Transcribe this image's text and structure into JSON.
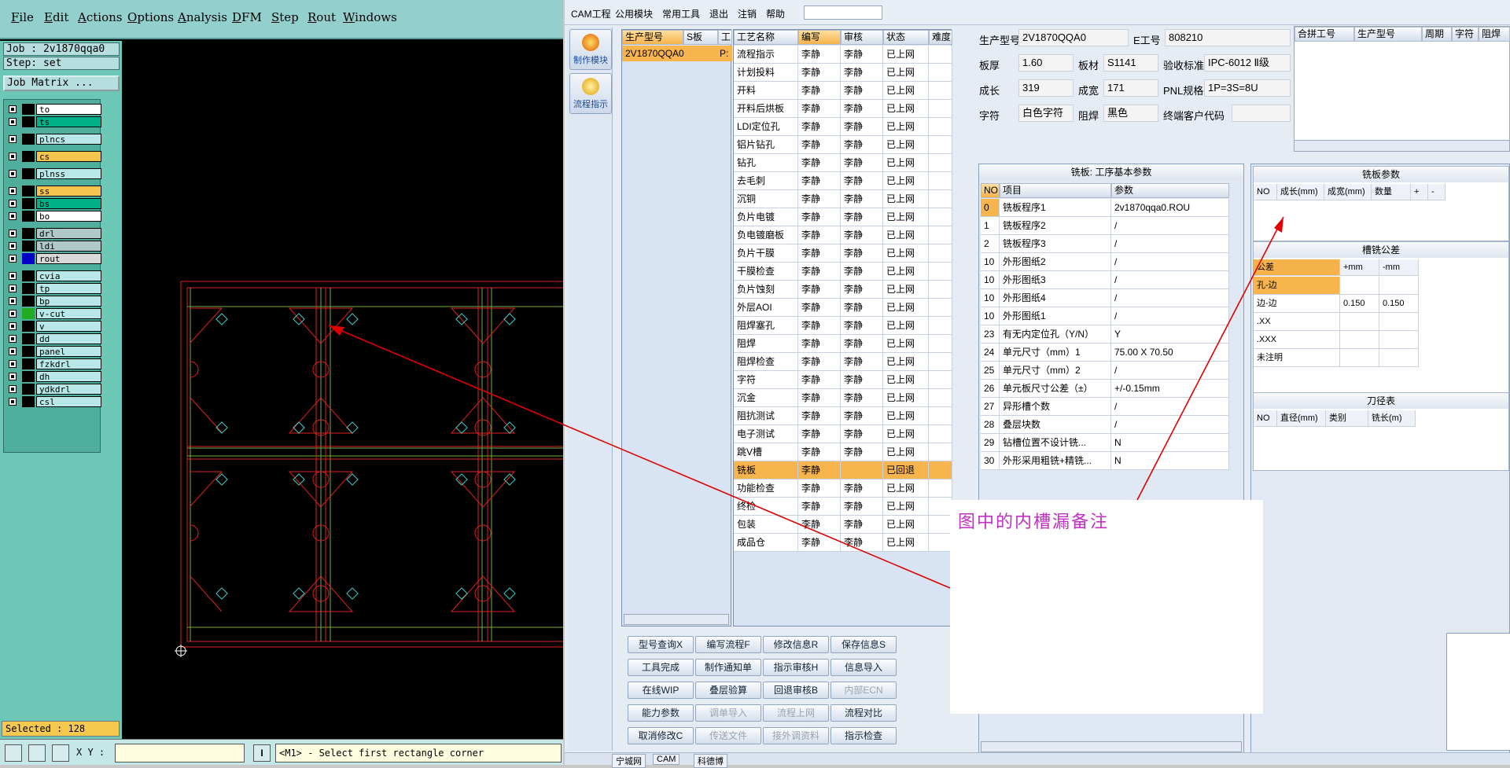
{
  "left_app": {
    "menu": [
      "File",
      "Edit",
      "Actions",
      "Options",
      "Analysis",
      "DFM",
      "Step",
      "Rout",
      "Windows"
    ],
    "job": "Job : 2v1870qqa0",
    "step": "Step: set",
    "job_matrix": "Job Matrix ...",
    "layers": [
      {
        "name": "to",
        "color": "#ffffff"
      },
      {
        "name": "ts",
        "color": "#00b28a"
      },
      {
        "name": "plncs",
        "color": "#b9e8e8"
      },
      {
        "name": "cs",
        "color": "#f6c54d"
      },
      {
        "name": "plnss",
        "color": "#b9e8e8"
      },
      {
        "name": "ss",
        "color": "#f6c54d"
      },
      {
        "name": "bs",
        "color": "#00b28a"
      },
      {
        "name": "bo",
        "color": "#ffffff"
      },
      {
        "name": "drl",
        "color": "#b0c8c8"
      },
      {
        "name": "ldi",
        "color": "#b0c8c8"
      },
      {
        "name": "rout",
        "color": "#d9d9d9"
      },
      {
        "name": "cvia",
        "color": "#b9e8e8"
      },
      {
        "name": "tp",
        "color": "#b9e8e8"
      },
      {
        "name": "bp",
        "color": "#b9e8e8"
      },
      {
        "name": "v-cut",
        "color": "#b9e8e8"
      },
      {
        "name": "v",
        "color": "#b9e8e8"
      },
      {
        "name": "dd",
        "color": "#b9e8e8"
      },
      {
        "name": "panel",
        "color": "#b9e8e8"
      },
      {
        "name": "fzkdrl",
        "color": "#b9e8e8"
      },
      {
        "name": "dh",
        "color": "#b9e8e8"
      },
      {
        "name": "ydkdrl",
        "color": "#b9e8e8"
      },
      {
        "name": "csl",
        "color": "#b9e8e8"
      }
    ],
    "selected": "Selected : 128",
    "coord_label": "X Y :",
    "prompt": "<M1> - Select first rectangle corner"
  },
  "right_app": {
    "menu": [
      "CAM工程",
      "公用模块",
      "常用工具",
      "退出",
      "注销",
      "帮助"
    ],
    "side_buttons": [
      "制作模块",
      "流程指示"
    ],
    "model_list": {
      "headers": [
        "生产型号",
        "S板",
        "工"
      ],
      "rows": [
        {
          "model": "2V1870QQA0",
          "s": "P:"
        }
      ]
    },
    "process": {
      "headers": [
        "工艺名称",
        "编写",
        "审核",
        "状态",
        "难度"
      ],
      "rows": [
        [
          "流程指示",
          "李静",
          "李静",
          "已上网",
          ""
        ],
        [
          "计划投料",
          "李静",
          "李静",
          "已上网",
          ""
        ],
        [
          "开料",
          "李静",
          "李静",
          "已上网",
          ""
        ],
        [
          "开料后烘板",
          "李静",
          "李静",
          "已上网",
          ""
        ],
        [
          "LDI定位孔",
          "李静",
          "李静",
          "已上网",
          ""
        ],
        [
          "铝片钻孔",
          "李静",
          "李静",
          "已上网",
          ""
        ],
        [
          "钻孔",
          "李静",
          "李静",
          "已上网",
          ""
        ],
        [
          "去毛刺",
          "李静",
          "李静",
          "已上网",
          ""
        ],
        [
          "沉铜",
          "李静",
          "李静",
          "已上网",
          ""
        ],
        [
          "负片电镀",
          "李静",
          "李静",
          "已上网",
          ""
        ],
        [
          "负电镀磨板",
          "李静",
          "李静",
          "已上网",
          ""
        ],
        [
          "负片干膜",
          "李静",
          "李静",
          "已上网",
          ""
        ],
        [
          "干膜检查",
          "李静",
          "李静",
          "已上网",
          ""
        ],
        [
          "负片蚀刻",
          "李静",
          "李静",
          "已上网",
          ""
        ],
        [
          "外层AOI",
          "李静",
          "李静",
          "已上网",
          ""
        ],
        [
          "阻焊塞孔",
          "李静",
          "李静",
          "已上网",
          ""
        ],
        [
          "阻焊",
          "李静",
          "李静",
          "已上网",
          ""
        ],
        [
          "阻焊检查",
          "李静",
          "李静",
          "已上网",
          ""
        ],
        [
          "字符",
          "李静",
          "李静",
          "已上网",
          ""
        ],
        [
          "沉金",
          "李静",
          "李静",
          "已上网",
          ""
        ],
        [
          "阻抗测试",
          "李静",
          "李静",
          "已上网",
          ""
        ],
        [
          "电子测试",
          "李静",
          "李静",
          "已上网",
          ""
        ],
        [
          "跳V槽",
          "李静",
          "李静",
          "已上网",
          ""
        ],
        [
          "铣板",
          "李静",
          "",
          "已回退",
          ""
        ],
        [
          "功能检查",
          "李静",
          "李静",
          "已上网",
          ""
        ],
        [
          "终检",
          "李静",
          "李静",
          "已上网",
          ""
        ],
        [
          "包装",
          "李静",
          "李静",
          "已上网",
          ""
        ],
        [
          "成品仓",
          "李静",
          "李静",
          "已上网",
          ""
        ]
      ],
      "selected_index": 23
    },
    "info": {
      "model_label": "生产型号",
      "model": "2V1870QQA0",
      "eng_label": "E工号",
      "eng": "808210",
      "thick_label": "板厚",
      "thick": "1.60",
      "mat_label": "板材",
      "mat": "S1141",
      "std_label": "验收标准",
      "std": "IPC-6012 Ⅱ级",
      "len_label": "成长",
      "len": "319",
      "wid_label": "成宽",
      "wid": "171",
      "pnl_label": "PNL规格",
      "pnl": "1P=3S=8U",
      "char_label": "字符",
      "char": "白色字符",
      "mask_label": "阻焊",
      "mask": "黑色",
      "cust_label": "终端客户代码",
      "cust": ""
    },
    "merge_headers": [
      "合拼工号",
      "生产型号",
      "周期",
      "字符",
      "阻焊"
    ],
    "params": {
      "title": "铣板: 工序基本参数",
      "headers": [
        "NO",
        "项目",
        "参数"
      ],
      "rows": [
        [
          "0",
          "铣板程序1",
          "2v1870qqa0.ROU"
        ],
        [
          "1",
          "铣板程序2",
          "/"
        ],
        [
          "2",
          "铣板程序3",
          "/"
        ],
        [
          "10",
          "外形图纸2",
          "/"
        ],
        [
          "10",
          "外形图纸3",
          "/"
        ],
        [
          "10",
          "外形图纸4",
          "/"
        ],
        [
          "10",
          "外形图纸1",
          "/"
        ],
        [
          "23",
          "有无内定位孔（Y/N）",
          "Y"
        ],
        [
          "24",
          "单元尺寸（mm）1",
          "75.00 X 70.50"
        ],
        [
          "25",
          "单元尺寸（mm）2",
          "/"
        ],
        [
          "26",
          "单元板尺寸公差（±）",
          "+/-0.15mm"
        ],
        [
          "27",
          "异形槽个数",
          "/"
        ],
        [
          "28",
          "叠层块数",
          "/"
        ],
        [
          "29",
          "钻槽位置不设计铣...",
          "N"
        ],
        [
          "30",
          "外形采用粗铣+精铣...",
          "N"
        ]
      ]
    },
    "mill_params": {
      "title": "铣板参数",
      "headers": [
        "NO",
        "成长(mm)",
        "成宽(mm)",
        "数量",
        "+",
        "-"
      ]
    },
    "tolerance": {
      "title": "槽铣公差",
      "headers": [
        "公差",
        "+mm",
        "-mm"
      ],
      "rows": [
        [
          "孔-边",
          "",
          ""
        ],
        [
          "边-边",
          "0.150",
          "0.150"
        ],
        [
          ".XX",
          "",
          ""
        ],
        [
          ".XXX",
          "",
          ""
        ],
        [
          "未注明",
          "",
          ""
        ]
      ]
    },
    "tools": {
      "title": "刀径表",
      "headers": [
        "NO",
        "直径(mm)",
        "类别",
        "铣长(m)"
      ]
    },
    "buttons": [
      [
        "型号查询X",
        "编写流程F",
        "修改信息R",
        "保存信息S"
      ],
      [
        "工具完成",
        "制作通知单",
        "指示审核H",
        "信息导入"
      ],
      [
        "在线WIP",
        "叠层验算",
        "回退审核B",
        "内部ECN"
      ],
      [
        "能力参数",
        "调单导入",
        "流程上网",
        "流程对比"
      ],
      [
        "取消修改C",
        "传送文件",
        "接外调资料",
        "指示检查"
      ]
    ],
    "disabled_buttons": [
      "内部ECN",
      "调单导入",
      "流程上网",
      "传送文件",
      "接外调资料"
    ],
    "status_tabs": [
      "宁城网",
      "CAM",
      "科德博"
    ]
  },
  "annotation": {
    "text": "图中的内槽漏备注",
    "color": "#c02fc0",
    "arrow_color": "#e00000"
  }
}
